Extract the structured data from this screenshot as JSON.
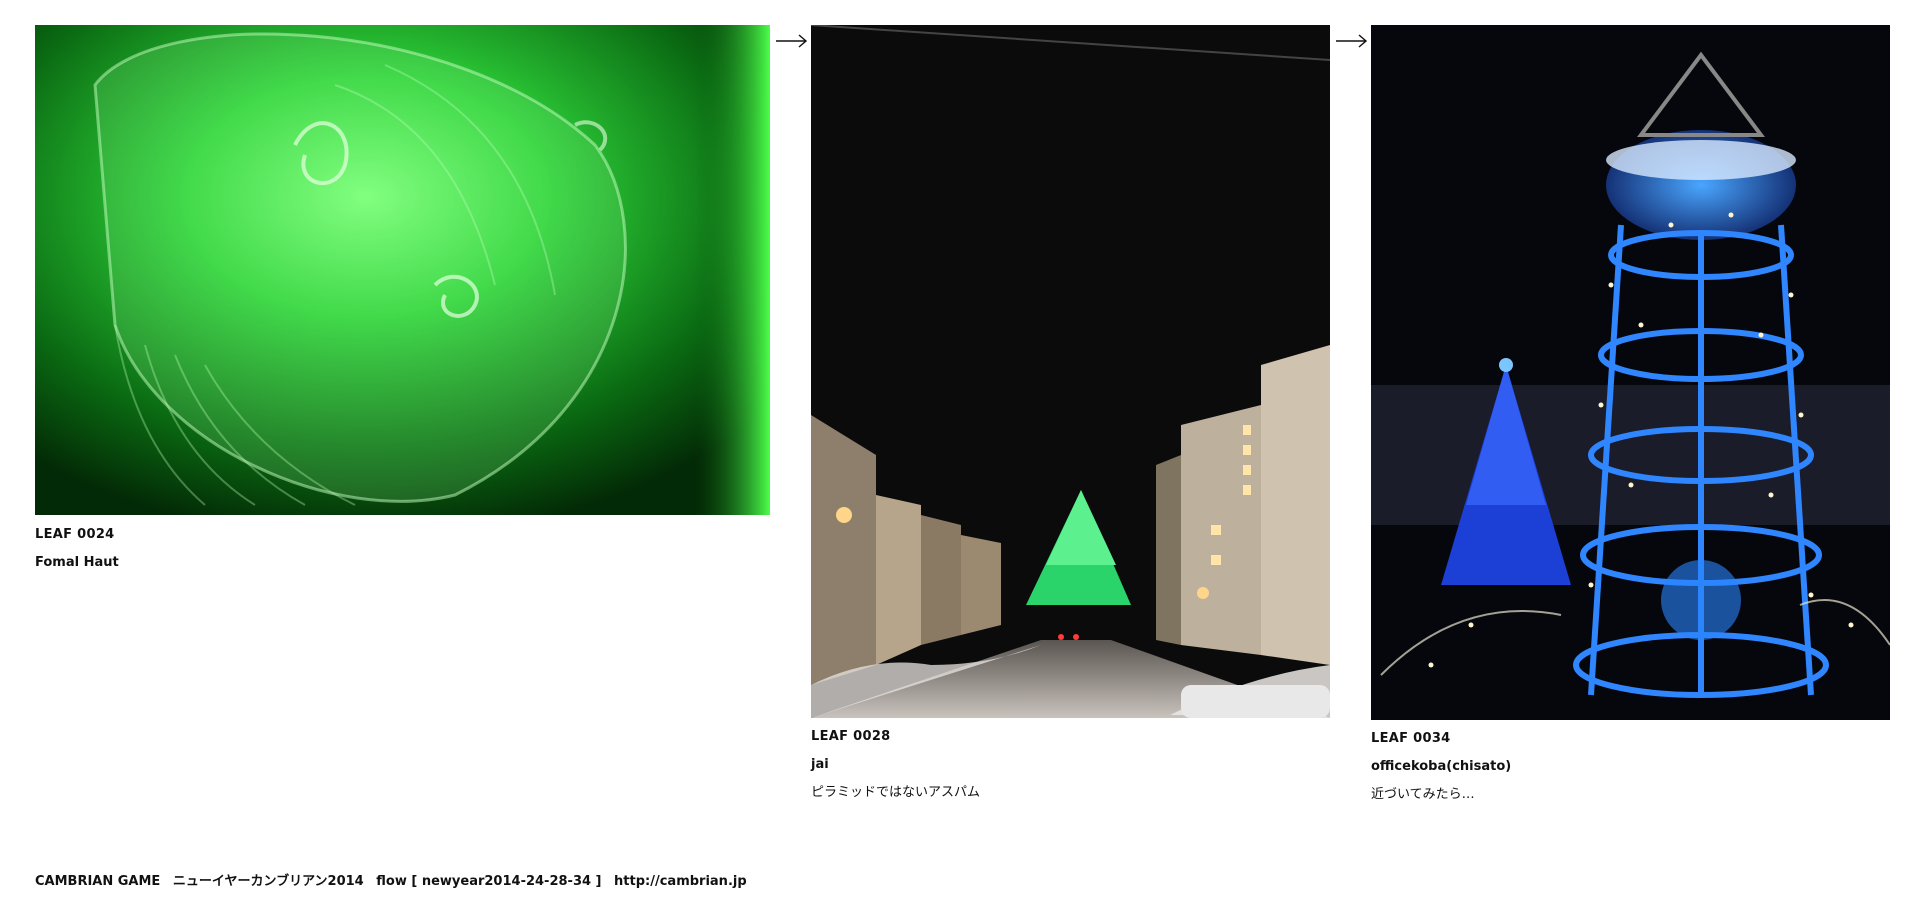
{
  "leaves": [
    {
      "id": "LEAF 0024",
      "author": "Fomal Haut",
      "comment": "",
      "image_subject": "green-jellyfish-photo"
    },
    {
      "id": "LEAF 0028",
      "author": "jai",
      "comment": "ピラミッドではないアスパム",
      "image_subject": "night-street-green-pyramid-photo"
    },
    {
      "id": "LEAF 0034",
      "author": "officekoba(chisato)",
      "comment": "近づいてみたら…",
      "image_subject": "blue-illuminated-tower-photo"
    }
  ],
  "arrows": [
    "right-arrow-icon",
    "right-arrow-icon"
  ],
  "footer": {
    "brand": "CAMBRIAN GAME",
    "event": "ニューイヤーカンブリアン2014",
    "flow": "flow [ newyear2014-24-28-34 ]",
    "url": "http://cambrian.jp"
  },
  "colors": {
    "background": "#ffffff",
    "text": "#111111"
  }
}
